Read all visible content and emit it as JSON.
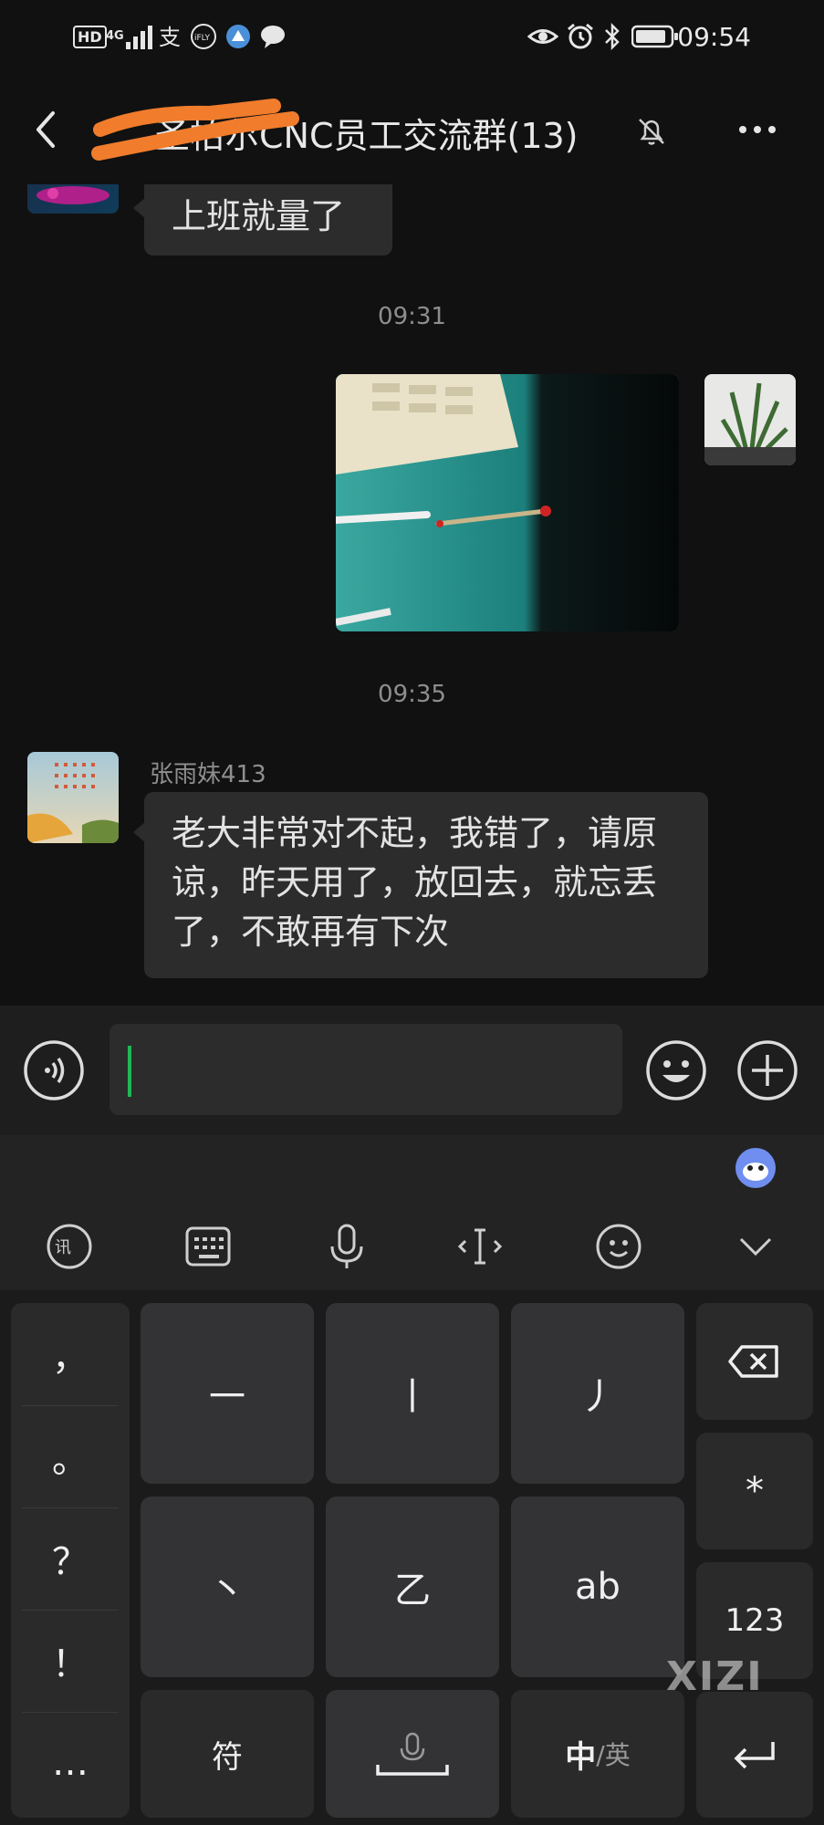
{
  "status_bar": {
    "time": "09:54",
    "network_badge": "HD",
    "network_type": "4G",
    "icons": [
      "hd-icon",
      "signal-icon",
      "alipay-icon",
      "ifly-icon",
      "browser-icon",
      "chat-bubble-icon",
      "eye-icon",
      "alarm-icon",
      "bluetooth-icon",
      "battery-icon"
    ]
  },
  "header": {
    "title": "圣柏尔CNC员工交流群(13)",
    "title_visible": "尔CNC员工交流群(13)",
    "back_icon": "chevron-left-icon",
    "mute_icon": "bell-off-icon",
    "more_icon": "more-horizontal-icon"
  },
  "chat": {
    "messages": [
      {
        "type": "text",
        "direction": "incoming",
        "text": "上班就量了"
      },
      {
        "type": "timestamp",
        "text": "09:31"
      },
      {
        "type": "image",
        "direction": "outgoing",
        "description": "photo"
      },
      {
        "type": "timestamp",
        "text": "09:35"
      },
      {
        "type": "text",
        "direction": "incoming",
        "sender": "张雨妹413",
        "text": "老大非常对不起，我错了，请原谅，昨天用了，放回去，就忘丢了，不敢再有下次"
      }
    ]
  },
  "input_bar": {
    "value": "",
    "voice_icon": "voice-icon",
    "emoji_icon": "emoji-icon",
    "plus_icon": "plus-circle-icon"
  },
  "keyboard": {
    "toolbar_icons": [
      "ifly-logo-icon",
      "keyboard-icon",
      "microphone-icon",
      "cursor-icon",
      "smiley-icon",
      "chevron-down-icon"
    ],
    "punctuation": [
      "，",
      "。",
      "？",
      "！",
      "…"
    ],
    "stroke_keys": [
      "一",
      "丨",
      "丿",
      "丶",
      "乙",
      "ab"
    ],
    "right_keys": {
      "star": "*",
      "num": "123"
    },
    "bottom": {
      "symbol": "符",
      "lang_primary": "中",
      "lang_secondary": "/英"
    },
    "watermark": "XIZI"
  },
  "colors": {
    "accent_green": "#1fb955",
    "bubble": "#2c2c2c",
    "background": "#111111"
  }
}
